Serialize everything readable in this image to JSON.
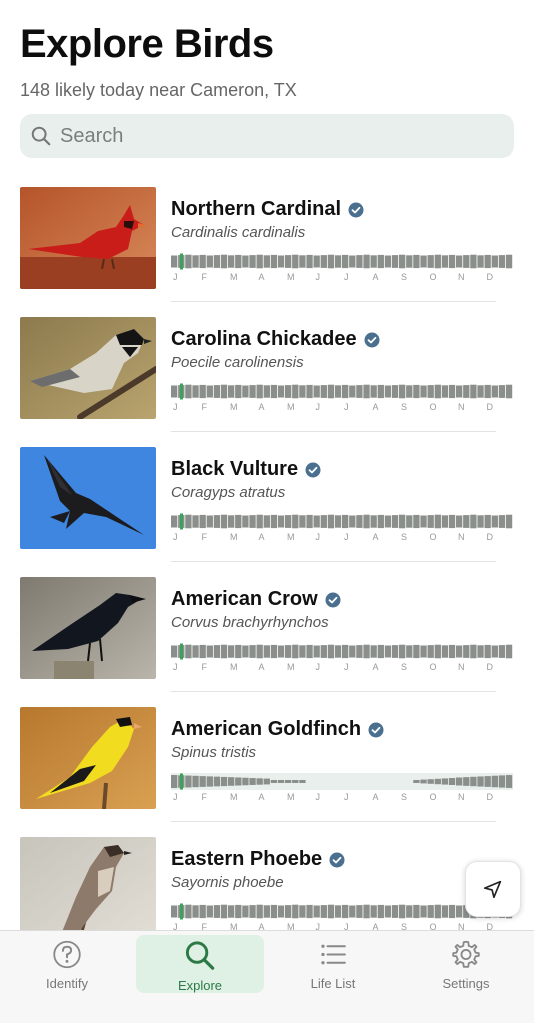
{
  "header": {
    "title": "Explore Birds",
    "subtitle": "148 likely today near Cameron, TX"
  },
  "search": {
    "placeholder": "Search"
  },
  "colors": {
    "accent_green": "#2b7a45",
    "verified_badge": "#4a6f8f",
    "bar_fill": "#8a8f8c",
    "bar_current_marker": "#3aa35b",
    "search_bg": "#e9efec"
  },
  "months": [
    "J",
    "F",
    "M",
    "A",
    "M",
    "J",
    "J",
    "A",
    "S",
    "O",
    "N",
    "D"
  ],
  "birds": [
    {
      "name": "Northern Cardinal",
      "scientific": "Cardinalis cardinalis",
      "verified": true,
      "image": "northern-cardinal-photo",
      "presence": "year-round"
    },
    {
      "name": "Carolina Chickadee",
      "scientific": "Poecile carolinensis",
      "verified": true,
      "image": "carolina-chickadee-photo",
      "presence": "year-round"
    },
    {
      "name": "Black Vulture",
      "scientific": "Coragyps atratus",
      "verified": true,
      "image": "black-vulture-photo",
      "presence": "year-round"
    },
    {
      "name": "American Crow",
      "scientific": "Corvus brachyrhynchos",
      "verified": true,
      "image": "american-crow-photo",
      "presence": "year-round"
    },
    {
      "name": "American Goldfinch",
      "scientific": "Spinus tristis",
      "verified": true,
      "image": "american-goldfinch-photo",
      "presence": "winter (Jan–Apr, Oct–Dec)"
    },
    {
      "name": "Eastern Phoebe",
      "scientific": "Sayornis phoebe",
      "verified": true,
      "image": "eastern-phoebe-photo",
      "presence": "year-round"
    }
  ],
  "location_button": {
    "icon": "navigation-arrow-icon"
  },
  "tabbar": {
    "tabs": [
      {
        "label": "Identify",
        "icon": "question-circle-icon",
        "active": false
      },
      {
        "label": "Explore",
        "icon": "search-icon",
        "active": true
      },
      {
        "label": "Life List",
        "icon": "list-icon",
        "active": false
      },
      {
        "label": "Settings",
        "icon": "gear-icon",
        "active": false
      }
    ]
  }
}
